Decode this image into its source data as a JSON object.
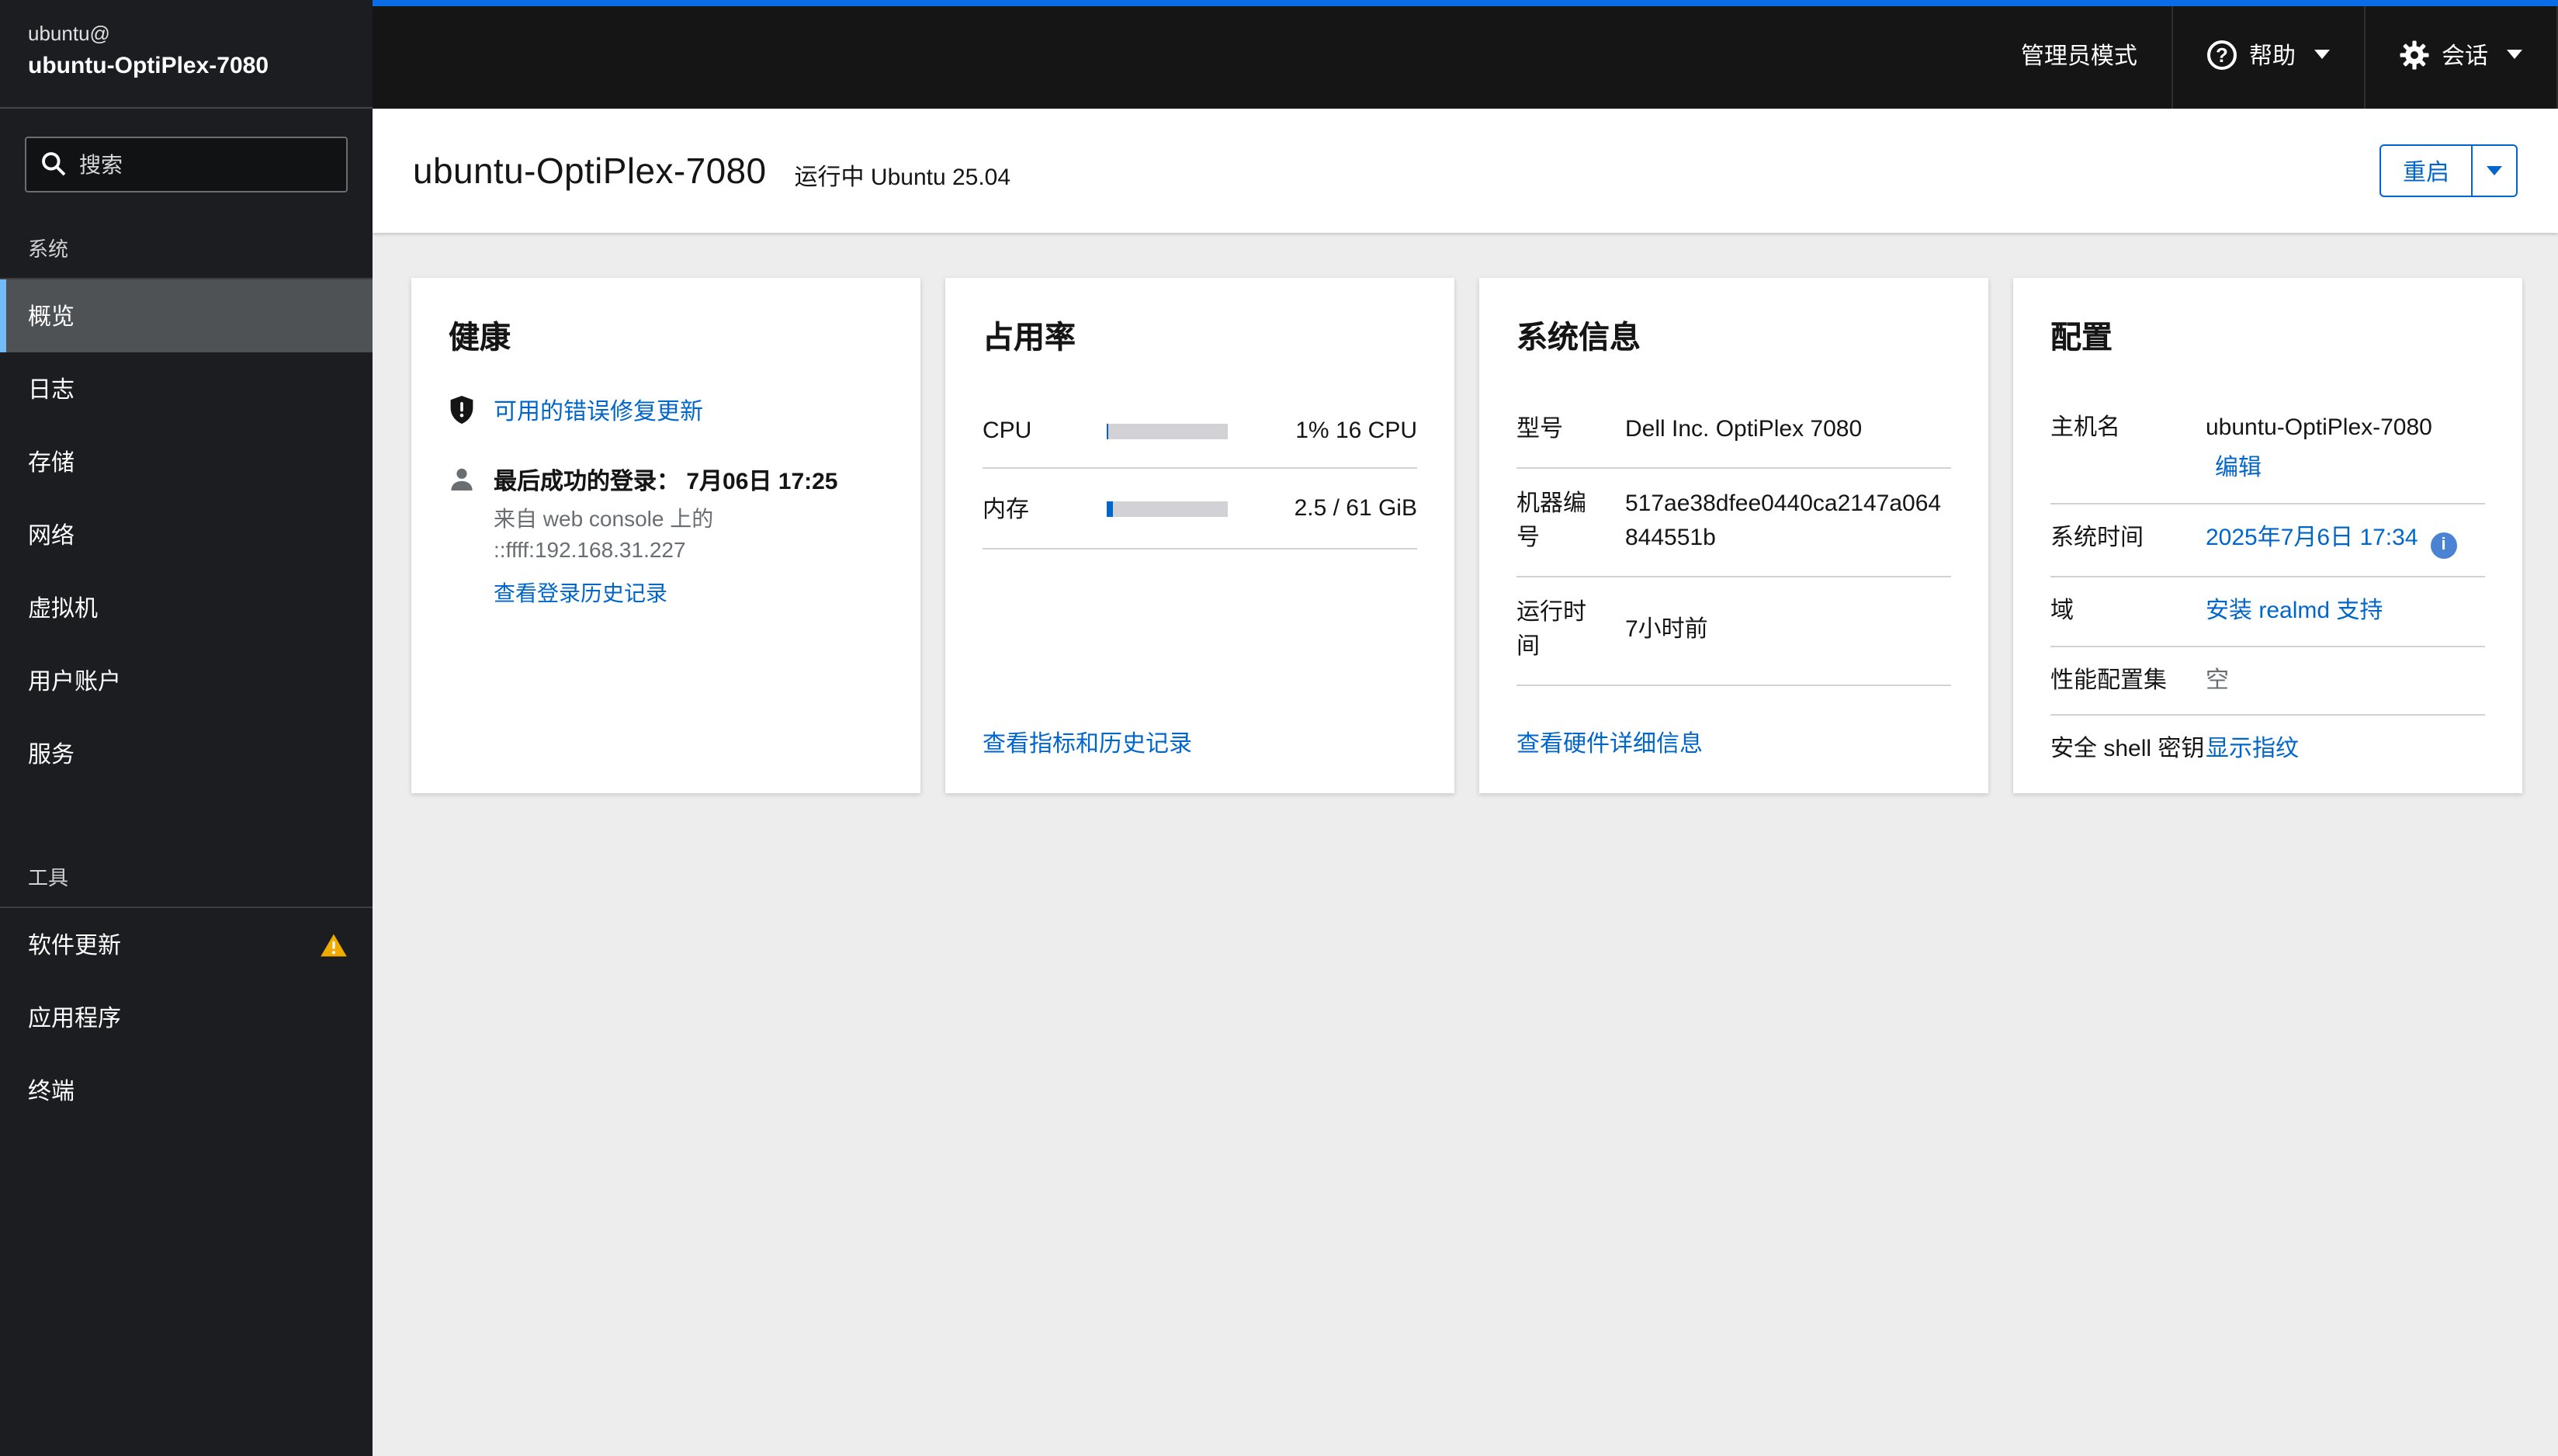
{
  "sidebar": {
    "user": "ubuntu@",
    "host": "ubuntu-OptiPlex-7080",
    "search_placeholder": "搜索",
    "sections": [
      {
        "label": "系统",
        "items": [
          {
            "label": "概览"
          },
          {
            "label": "日志"
          },
          {
            "label": "存储"
          },
          {
            "label": "网络"
          },
          {
            "label": "虚拟机"
          },
          {
            "label": "用户账户"
          },
          {
            "label": "服务"
          }
        ]
      },
      {
        "label": "工具",
        "items": [
          {
            "label": "软件更新"
          },
          {
            "label": "应用程序"
          },
          {
            "label": "终端"
          }
        ]
      }
    ]
  },
  "masthead": {
    "admin_mode": "管理员模式",
    "help": "帮助",
    "help_icon": "question-circle-icon",
    "session": "会话",
    "session_icon": "gear-icon",
    "accent_color": "#0a6ce6"
  },
  "header": {
    "title": "ubuntu-OptiPlex-7080",
    "state": "运行中",
    "os": "Ubuntu 25.04",
    "restart_label": "重启"
  },
  "cards": {
    "health": {
      "title": "健康",
      "updates_link": "可用的错误修复更新",
      "updates_icon": "shield-exclamation-icon",
      "last_login_label": "最后成功的登录：",
      "last_login_time": "7月06日 17:25",
      "login_origin_line1": "来自 web console 上的",
      "login_origin_line2": "::ffff:192.168.31.227",
      "history_link": "查看登录历史记录"
    },
    "usage": {
      "title": "占用率",
      "cpu_label": "CPU",
      "cpu_value": "1% 16 CPU",
      "cpu_percent": 1.5,
      "mem_label": "内存",
      "mem_value": "2.5 / 61 GiB",
      "mem_percent": 4.5,
      "link": "查看指标和历史记录",
      "bar_fill_color": "#0066cc"
    },
    "sysinfo": {
      "title": "系统信息",
      "rows": [
        {
          "label": "型号",
          "value": "Dell Inc. OptiPlex 7080"
        },
        {
          "label": "机器编号",
          "value": "517ae38dfee0440ca2147a064844551b"
        },
        {
          "label": "运行时间",
          "value": "7小时前"
        }
      ],
      "link": "查看硬件详细信息"
    },
    "config": {
      "title": "配置",
      "hostname_label": "主机名",
      "hostname_value": "ubuntu-OptiPlex-7080",
      "edit_link": "编辑",
      "time_label": "系统时间",
      "time_value": "2025年7月6日 17:34",
      "time_info_icon": "info-circle-icon",
      "domain_label": "域",
      "domain_link": "安装 realmd 支持",
      "profile_label": "性能配置集",
      "profile_value": "空",
      "ssh_label": "安全 shell 密钥",
      "ssh_link": "显示指纹"
    }
  }
}
